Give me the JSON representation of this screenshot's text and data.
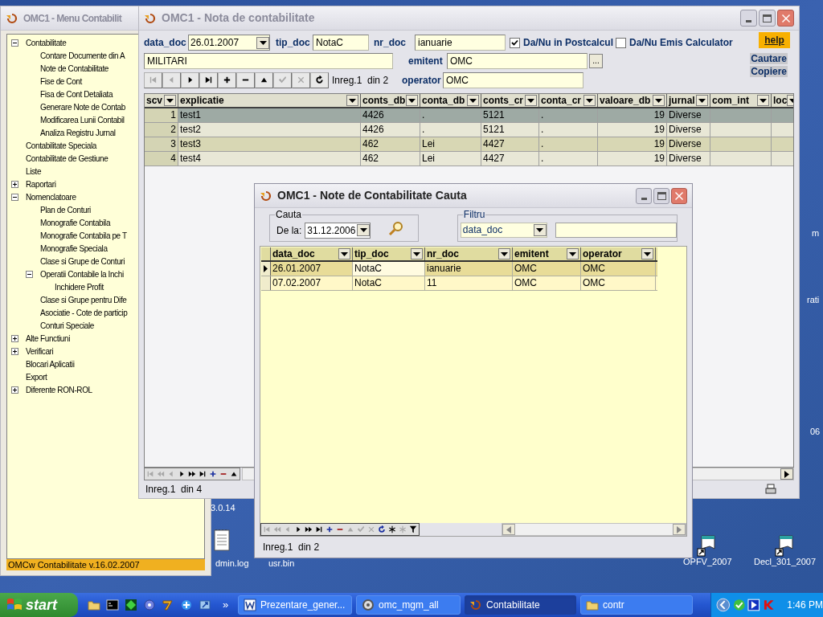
{
  "desktop_icons": [
    {
      "label": "m",
      "kind": "fragment"
    },
    {
      "label": "rati",
      "kind": "fragment"
    },
    {
      "label": "06",
      "kind": "fragment"
    },
    {
      "label": "3.0.14",
      "kind": "fragment"
    },
    {
      "label": "dmin.log",
      "kind": "file"
    },
    {
      "label": "usr.bin",
      "kind": "file"
    },
    {
      "label": "OPFV_2007",
      "kind": "shortcut"
    },
    {
      "label": "Decl_301_2007",
      "kind": "shortcut"
    }
  ],
  "menu_window": {
    "title": "OMC1 - Menu Contabilit",
    "active": false,
    "tree": [
      {
        "label": "Contabilitate",
        "expanded": true,
        "children": [
          {
            "label": "Contare Documente din A"
          },
          {
            "label": "Note de Contabilitate"
          },
          {
            "label": "Fise de Cont"
          },
          {
            "label": "Fisa de Cont Detaliata"
          },
          {
            "label": "Generare Note de Contab"
          },
          {
            "label": "Modificarea Lunii Contabil"
          },
          {
            "label": "Analiza Registru Jurnal"
          }
        ]
      },
      {
        "label": "Contabilitate Speciala"
      },
      {
        "label": "Contabilitate de Gestiune"
      },
      {
        "label": "Liste"
      },
      {
        "label": "Raportari",
        "expanded": false
      },
      {
        "label": "Nomenclatoare",
        "expanded": true,
        "children": [
          {
            "label": "Plan de Conturi"
          },
          {
            "label": "Monografie Contabila"
          },
          {
            "label": "Monografie Contabila pe T"
          },
          {
            "label": "Monografie Speciala"
          },
          {
            "label": "Clase si Grupe de Conturi"
          },
          {
            "label": "Operatii Contabile la Inchi",
            "expanded": true,
            "children": [
              {
                "label": "Inchidere Profit"
              }
            ]
          },
          {
            "label": "Clase si Grupe pentru Dife"
          },
          {
            "label": "Asociatie - Cote de particip"
          },
          {
            "label": "Conturi Speciale"
          }
        ]
      },
      {
        "label": "Alte Functiuni",
        "expanded": false
      },
      {
        "label": "Verificari",
        "expanded": false
      },
      {
        "label": "Blocari Aplicatii"
      },
      {
        "label": "Export"
      },
      {
        "label": "Diferente RON-ROL",
        "expanded": false
      }
    ],
    "status": "OMCw Contabilitate v.16.02.2007"
  },
  "main_window": {
    "title": "OMC1 - Nota de contabilitate",
    "active": false,
    "data_doc": {
      "label": "data_doc",
      "value": "26.01.2007"
    },
    "tip_doc": {
      "label": "tip_doc",
      "value": "NotaC"
    },
    "nr_doc": {
      "label": "nr_doc",
      "value": "ianuarie"
    },
    "checkboxes": [
      {
        "label": "Da/Nu in Postcalcul",
        "checked": true
      },
      {
        "label": "Da/Nu Emis Calculator",
        "checked": false
      }
    ],
    "help_button": "help",
    "explicatie_value": "MILITARI",
    "emitent": {
      "label": "emitent",
      "value": "OMC"
    },
    "browse_button": "...",
    "operator": {
      "label": "operator",
      "value": "OMC"
    },
    "links": [
      "Cautare",
      "Copiere"
    ],
    "navigator": [
      {
        "kind": "first",
        "disabled": true
      },
      {
        "kind": "prior",
        "disabled": true
      },
      {
        "kind": "next",
        "disabled": false
      },
      {
        "kind": "last",
        "disabled": false
      },
      {
        "kind": "insert",
        "disabled": false
      },
      {
        "kind": "delete",
        "disabled": false
      },
      {
        "kind": "edit",
        "disabled": false
      },
      {
        "kind": "post",
        "disabled": true
      },
      {
        "kind": "cancel",
        "disabled": true
      },
      {
        "kind": "refresh",
        "disabled": false
      }
    ],
    "record": "Inreg.1  din 2",
    "table": {
      "columns": [
        "scv",
        "explicatie",
        "conts_db",
        "conta_db",
        "conts_cr",
        "conta_cr",
        "valoare_db",
        "jurnal",
        "com_int",
        "loc"
      ],
      "rows": [
        {
          "cells": [
            "1",
            "test1",
            "4426",
            ".",
            "5121",
            ".",
            "19",
            "Diverse",
            "",
            ""
          ],
          "selected": true
        },
        {
          "cells": [
            "2",
            "test2",
            "4426",
            ".",
            "5121",
            ".",
            "19",
            "Diverse",
            "",
            ""
          ],
          "selected": false
        },
        {
          "cells": [
            "3",
            "test3",
            "462",
            "Lei",
            "4427",
            ".",
            "19",
            "Diverse",
            "",
            ""
          ],
          "selected": false
        },
        {
          "cells": [
            "4",
            "test4",
            "462",
            "Lei",
            "4427",
            ".",
            "19",
            "Diverse",
            "",
            ""
          ],
          "selected": false
        }
      ]
    },
    "grid_navigator": [
      {
        "kind": "first",
        "disabled": true
      },
      {
        "kind": "prior-page",
        "disabled": true
      },
      {
        "kind": "prior",
        "disabled": true
      },
      {
        "kind": "next",
        "disabled": false
      },
      {
        "kind": "next-page",
        "disabled": false
      },
      {
        "kind": "last",
        "disabled": false
      },
      {
        "kind": "insert",
        "disabled": false
      },
      {
        "kind": "delete",
        "disabled": false
      },
      {
        "kind": "edit",
        "disabled": false
      }
    ],
    "status": "Inreg.1  din 4"
  },
  "search_dialog": {
    "title": "OMC1 - Note de Contabilitate Cauta",
    "active": true,
    "cauta_group": "Cauta",
    "de_la": {
      "label": "De la:",
      "value": "31.12.2006"
    },
    "filtru_group": "Filtru",
    "filter_field": "data_doc",
    "table": {
      "columns": [
        "data_doc",
        "tip_doc",
        "nr_doc",
        "emitent",
        "operator"
      ],
      "rows": [
        {
          "cells": [
            "26.01.2007",
            "NotaC",
            "ianuarie",
            "OMC",
            "OMC"
          ],
          "selected": true
        },
        {
          "cells": [
            "07.02.2007",
            "NotaC",
            "11",
            "OMC",
            "OMC"
          ],
          "selected": false
        }
      ]
    },
    "grid_navigator": [
      {
        "kind": "first",
        "disabled": true
      },
      {
        "kind": "prior-page",
        "disabled": true
      },
      {
        "kind": "prior",
        "disabled": true
      },
      {
        "kind": "next",
        "disabled": false
      },
      {
        "kind": "next-page",
        "disabled": false
      },
      {
        "kind": "last",
        "disabled": false
      },
      {
        "kind": "insert",
        "disabled": false
      },
      {
        "kind": "delete",
        "disabled": false
      },
      {
        "kind": "edit",
        "disabled": true
      },
      {
        "kind": "post",
        "disabled": true
      },
      {
        "kind": "cancel",
        "disabled": true
      },
      {
        "kind": "refresh",
        "disabled": false
      },
      {
        "kind": "asterisk",
        "disabled": false
      },
      {
        "kind": "asterisk",
        "disabled": true
      },
      {
        "kind": "filter",
        "disabled": false
      }
    ],
    "status": "Inreg.1  din 2"
  },
  "taskbar": {
    "start": "start",
    "tasks": [
      {
        "label": "Prezentare_gener...",
        "kind": "word",
        "selected": false
      },
      {
        "label": "omc_mgm_all",
        "kind": "app",
        "selected": false
      },
      {
        "label": "Contabilitate",
        "kind": "omc",
        "selected": true
      },
      {
        "label": "contr",
        "kind": "folder",
        "selected": false
      }
    ],
    "overflow": "»",
    "clock": "1:46 PM"
  }
}
